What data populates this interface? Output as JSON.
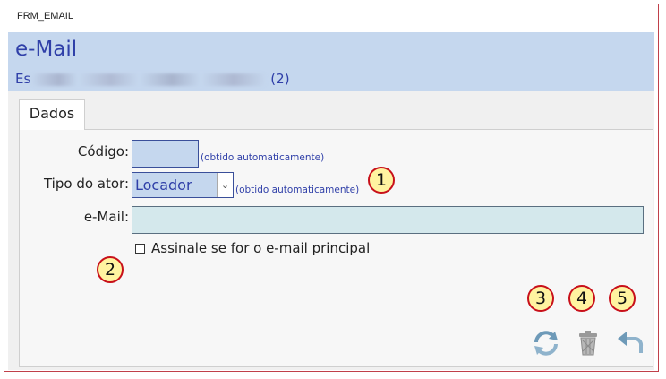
{
  "window": {
    "title": "FRM_EMAIL"
  },
  "header": {
    "title": "e-Mail",
    "subtitle_visible": "Es",
    "subtitle_tail": "(2)"
  },
  "tabs": [
    {
      "label": "Dados"
    }
  ],
  "form": {
    "codigo_label": "Código:",
    "codigo_value": "",
    "codigo_hint": "(obtido automaticamente)",
    "tipo_label": "Tipo do ator:",
    "tipo_value": "Locador",
    "tipo_hint": "(obtido automaticamente)",
    "email_label": "e-Mail:",
    "email_value": "",
    "principal_label": "Assinale se for o e-mail principal",
    "principal_checked": false
  },
  "annotations": [
    "1",
    "2",
    "3",
    "4",
    "5"
  ],
  "actions": [
    {
      "icon": "refresh-icon"
    },
    {
      "icon": "trash-icon"
    },
    {
      "icon": "undo-icon"
    }
  ],
  "colors": {
    "accent": "#2f3fa8",
    "header_bg": "#c5d7ee",
    "frame_border": "#c0404a",
    "badge_fill": "#fff3a0",
    "badge_border": "#c8101a"
  }
}
